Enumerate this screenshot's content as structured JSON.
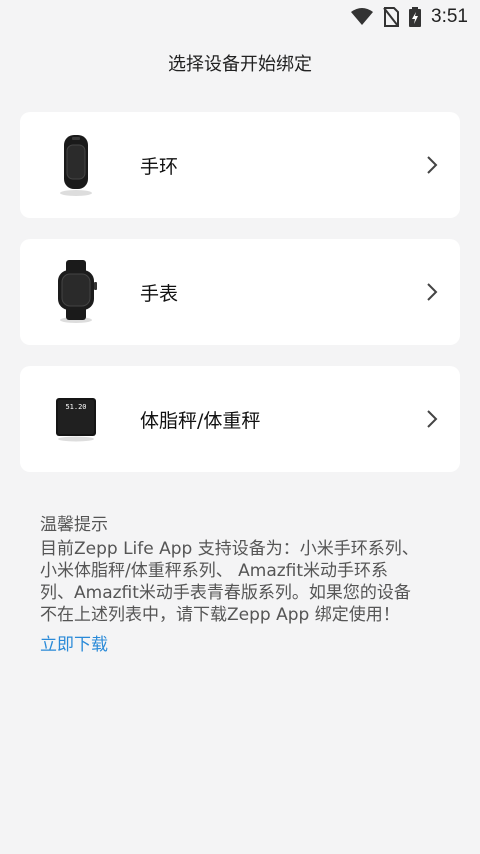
{
  "status_bar": {
    "time": "3:51",
    "icons": [
      "wifi-icon",
      "no-sim-icon",
      "battery-charging-icon"
    ]
  },
  "header": {
    "title": "选择设备开始绑定"
  },
  "devices": [
    {
      "label": "手环",
      "icon": "band-icon"
    },
    {
      "label": "手表",
      "icon": "watch-icon"
    },
    {
      "label": "体脂秤/体重秤",
      "icon": "scale-icon",
      "scale_display": "51.20"
    }
  ],
  "tips": {
    "title": "温馨提示",
    "lines": [
      "目前Zepp Life App 支持设备为：小米手环系列、",
      "小米体脂秤/体重秤系列、 Amazfit米动手环系",
      "列、Amazfit米动手表青春版系列。如果您的设备",
      "不在上述列表中，请下载Zepp App 绑定使用！"
    ],
    "link_label": "立即下载"
  },
  "colors": {
    "background": "#f4f4f5",
    "card": "#ffffff",
    "link": "#2a8ad8"
  }
}
